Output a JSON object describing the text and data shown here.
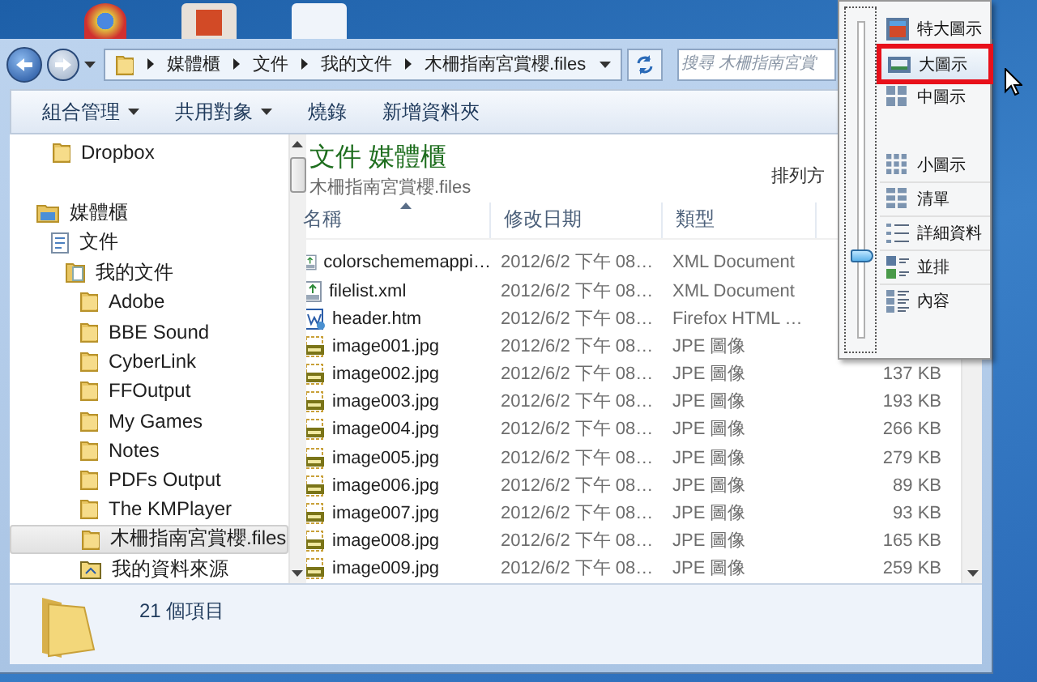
{
  "address_bar": {
    "crumbs": [
      "媒體櫃",
      "文件",
      "我的文件",
      "木柵指南宮賞櫻.files"
    ]
  },
  "search": {
    "placeholder": "搜尋 木柵指南宮賞"
  },
  "toolbar": [
    {
      "label": "組合管理",
      "has_menu": true
    },
    {
      "label": "共用對象",
      "has_menu": true
    },
    {
      "label": "燒錄",
      "has_menu": false
    },
    {
      "label": "新增資料夾",
      "has_menu": false
    }
  ],
  "navigation": {
    "favorites": [
      {
        "label": "Dropbox",
        "kind": "folder",
        "selected": false
      }
    ],
    "libraries": [
      {
        "label": "媒體櫃",
        "kind": "library",
        "selected": false,
        "children": [
          {
            "label": "文件",
            "kind": "document",
            "selected": false,
            "children": [
              {
                "label": "我的文件",
                "kind": "docfolder",
                "selected": false,
                "children": [
                  {
                    "label": "Adobe",
                    "kind": "folder",
                    "selected": false
                  },
                  {
                    "label": "BBE Sound",
                    "kind": "folder",
                    "selected": false
                  },
                  {
                    "label": "CyberLink",
                    "kind": "folder",
                    "selected": false
                  },
                  {
                    "label": "FFOutput",
                    "kind": "folder",
                    "selected": false
                  },
                  {
                    "label": "My Games",
                    "kind": "folder",
                    "selected": false
                  },
                  {
                    "label": "Notes",
                    "kind": "folder",
                    "selected": false
                  },
                  {
                    "label": "PDFs Output",
                    "kind": "folder",
                    "selected": false
                  },
                  {
                    "label": "The KMPlayer",
                    "kind": "folder",
                    "selected": false
                  },
                  {
                    "label": "木柵指南宮賞櫻.files",
                    "kind": "folder",
                    "selected": true
                  },
                  {
                    "label": "我的資料來源",
                    "kind": "source",
                    "selected": false
                  }
                ]
              }
            ]
          }
        ]
      }
    ]
  },
  "library_header": {
    "title": "文件 媒體櫃",
    "subtitle": "木柵指南宮賞櫻.files",
    "arrange_label": "排列方"
  },
  "columns": [
    "名稱",
    "修改日期",
    "類型"
  ],
  "rows": [
    {
      "kind": "xml",
      "name": "colorschememappi…",
      "date": "2012/6/2 下午 08…",
      "type": "XML Document"
    },
    {
      "kind": "xml",
      "name": "filelist.xml",
      "date": "2012/6/2 下午 08…",
      "type": "XML Document"
    },
    {
      "kind": "html",
      "name": "header.htm",
      "date": "2012/6/2 下午 08…",
      "type": "Firefox HTML …"
    },
    {
      "kind": "image",
      "name": "image001.jpg",
      "date": "2012/6/2 下午 08…",
      "type": "JPE 圖像"
    },
    {
      "kind": "image",
      "name": "image002.jpg",
      "date": "2012/6/2 下午 08…",
      "type": "JPE 圖像",
      "size": "137 KB"
    },
    {
      "kind": "image",
      "name": "image003.jpg",
      "date": "2012/6/2 下午 08…",
      "type": "JPE 圖像",
      "size": "193 KB"
    },
    {
      "kind": "image",
      "name": "image004.jpg",
      "date": "2012/6/2 下午 08…",
      "type": "JPE 圖像",
      "size": "266 KB"
    },
    {
      "kind": "image",
      "name": "image005.jpg",
      "date": "2012/6/2 下午 08…",
      "type": "JPE 圖像",
      "size": "279 KB"
    },
    {
      "kind": "image",
      "name": "image006.jpg",
      "date": "2012/6/2 下午 08…",
      "type": "JPE 圖像",
      "size": "89 KB"
    },
    {
      "kind": "image",
      "name": "image007.jpg",
      "date": "2012/6/2 下午 08…",
      "type": "JPE 圖像",
      "size": "93 KB"
    },
    {
      "kind": "image",
      "name": "image008.jpg",
      "date": "2012/6/2 下午 08…",
      "type": "JPE 圖像",
      "size": "165 KB"
    },
    {
      "kind": "image",
      "name": "image009.jpg",
      "date": "2012/6/2 下午 08…",
      "type": "JPE 圖像",
      "size": "259 KB"
    }
  ],
  "status_bar": {
    "count": "21 個項目"
  },
  "view_menu": {
    "level": 0.26,
    "items": [
      {
        "label": "特大圖示",
        "kind": "extra-large",
        "selected": false,
        "outlined": false
      },
      {
        "label": "大圖示",
        "kind": "large",
        "selected": true,
        "outlined": true
      },
      {
        "label": "中圖示",
        "kind": "medium",
        "selected": false,
        "outlined": false
      },
      {
        "label": "小圖示",
        "kind": "small",
        "selected": false,
        "outlined": false
      },
      {
        "label": "清單",
        "kind": "list",
        "selected": false,
        "outlined": false
      },
      {
        "label": "詳細資料",
        "kind": "details",
        "selected": false,
        "outlined": false
      },
      {
        "label": "並排",
        "kind": "tiles",
        "selected": false,
        "outlined": false
      },
      {
        "label": "內容",
        "kind": "content",
        "selected": false,
        "outlined": false
      }
    ]
  }
}
